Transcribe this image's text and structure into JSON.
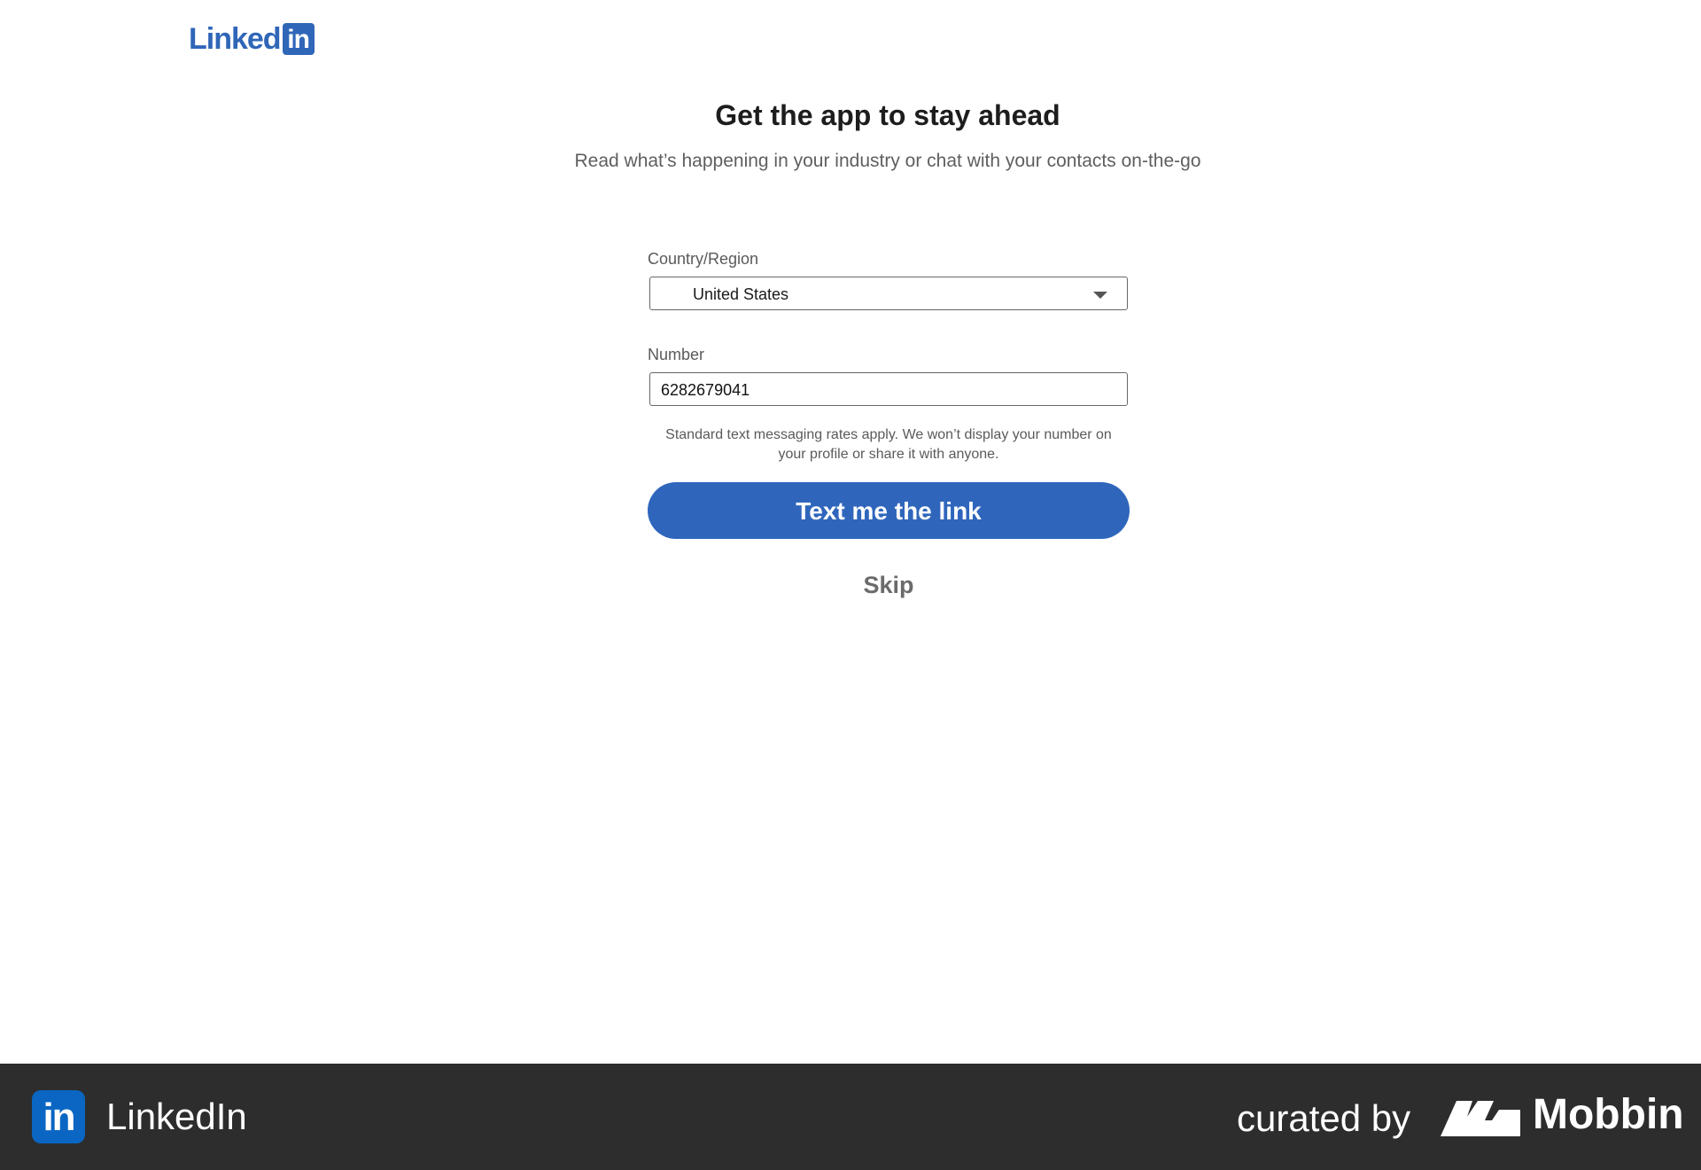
{
  "header": {
    "logo_text": "Linked",
    "logo_box_text": "in"
  },
  "main": {
    "title": "Get the app to stay ahead",
    "subtitle": "Read what’s happening in your industry or chat with your contacts on-the-go"
  },
  "form": {
    "country_label": "Country/Region",
    "country_value": "United States",
    "number_label": "Number",
    "number_value": "6282679041",
    "disclaimer": "Standard text messaging rates apply. We won’t display your number on your profile or share it with anyone.",
    "submit_label": "Text me the link",
    "skip_label": "Skip"
  },
  "footer": {
    "app_icon_text": "in",
    "app_name": "LinkedIn",
    "curated_by": "curated by",
    "brand": "Mobbin"
  },
  "colors": {
    "brand_blue": "#2f66bc",
    "footer_bg": "#2d2d2d"
  },
  "icons": {
    "dropdown": "chevron-down-icon",
    "mobbin_logo": "mobbin-logo-icon"
  }
}
